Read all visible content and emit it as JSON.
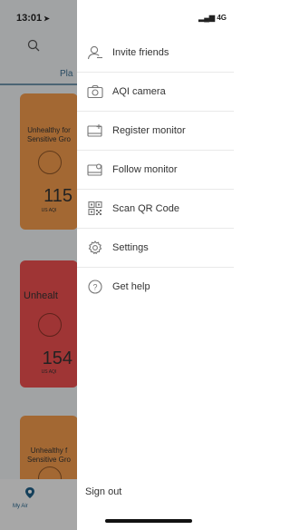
{
  "status": {
    "time": "13:01",
    "network": "4G"
  },
  "background": {
    "tab_label": "Pla",
    "cards": [
      {
        "status": "Unhealthy for Sensitive Gro",
        "value": "115",
        "unit": "US AQI"
      },
      {
        "status": "Unhealt",
        "value": "154",
        "unit": "US AQI"
      },
      {
        "status": "Unhealthy f Sensitive Gro"
      }
    ],
    "tabbar_label": "My Air"
  },
  "menu": {
    "items": [
      {
        "label": "Invite friends",
        "icon": "person-add-icon"
      },
      {
        "label": "AQI camera",
        "icon": "camera-icon"
      },
      {
        "label": "Register monitor",
        "icon": "register-monitor-icon"
      },
      {
        "label": "Follow monitor",
        "icon": "follow-monitor-icon"
      },
      {
        "label": "Scan QR Code",
        "icon": "qr-code-icon"
      },
      {
        "label": "Settings",
        "icon": "gear-icon"
      },
      {
        "label": "Get help",
        "icon": "help-icon"
      }
    ],
    "sign_out": "Sign out"
  }
}
